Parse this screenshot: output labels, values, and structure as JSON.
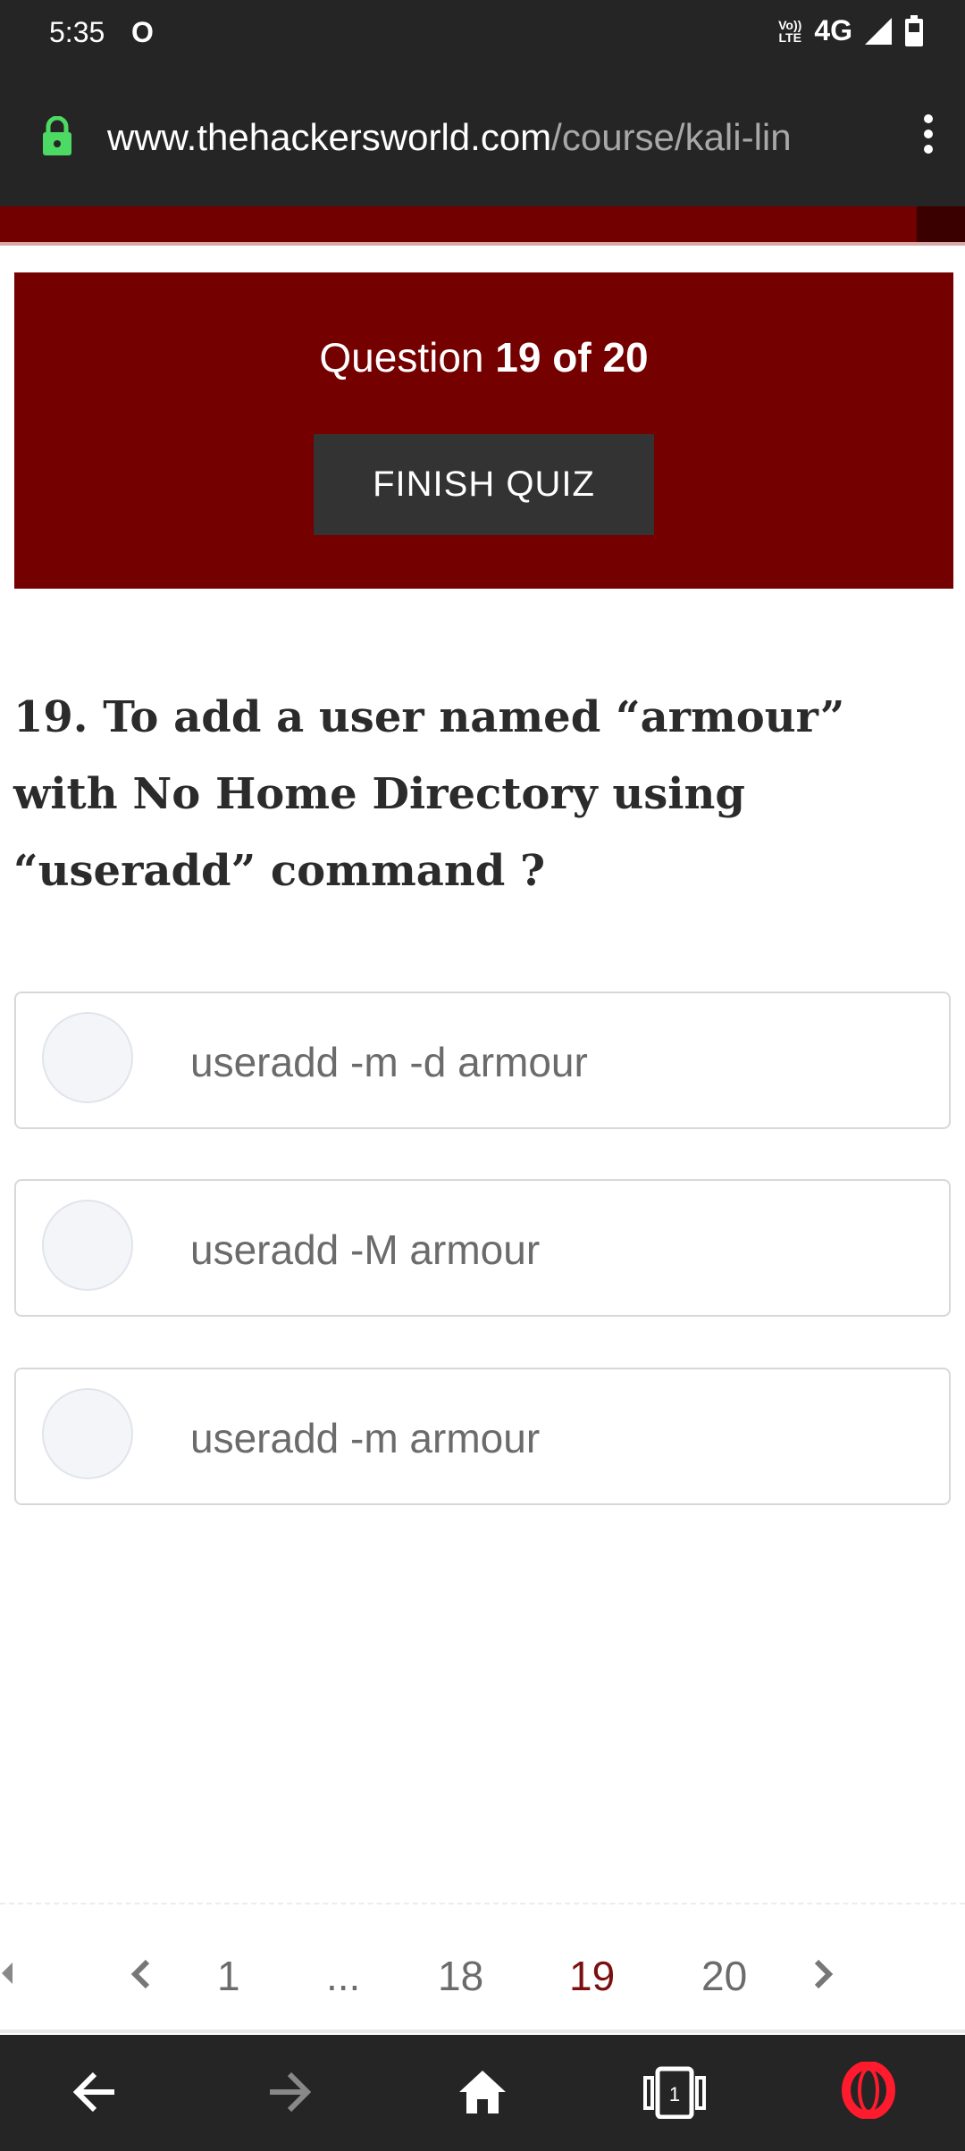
{
  "status_bar": {
    "time": "5:35",
    "opera_icon": "opera-o-icon",
    "volte_line1": "Vo))",
    "volte_line2": "LTE",
    "network": "4G",
    "signal_icon": "signal-icon",
    "battery_icon": "battery-icon"
  },
  "browser": {
    "url_host": "www.thehackersworld.com",
    "url_path": "/course/kali-lin",
    "lock_icon": "lock-icon",
    "lock_color": "#4cd964",
    "menu_icon": "more-vert-icon"
  },
  "quiz": {
    "progress_fraction": 0.95,
    "question_prefix": "Question ",
    "question_current": "19 of 20",
    "finish_label": "FINISH QUIZ",
    "accent_color": "#750000",
    "question_text": "19. To add a user named “armour” with No Home Directory using “useradd” command ?",
    "options": [
      {
        "label": "useradd -m -d armour"
      },
      {
        "label": "useradd -M armour"
      },
      {
        "label": "useradd -m armour"
      }
    ]
  },
  "pagination": {
    "pages": [
      "1",
      "...",
      "18",
      "19",
      "20"
    ],
    "active": "19",
    "prev_icon": "chevron-left-icon",
    "next_icon": "chevron-right-icon"
  },
  "bottom_nav": {
    "back_icon": "back-arrow-icon",
    "forward_icon": "forward-arrow-icon",
    "home_icon": "home-icon",
    "tabs_count": "1",
    "opera_icon": "opera-logo-icon"
  }
}
